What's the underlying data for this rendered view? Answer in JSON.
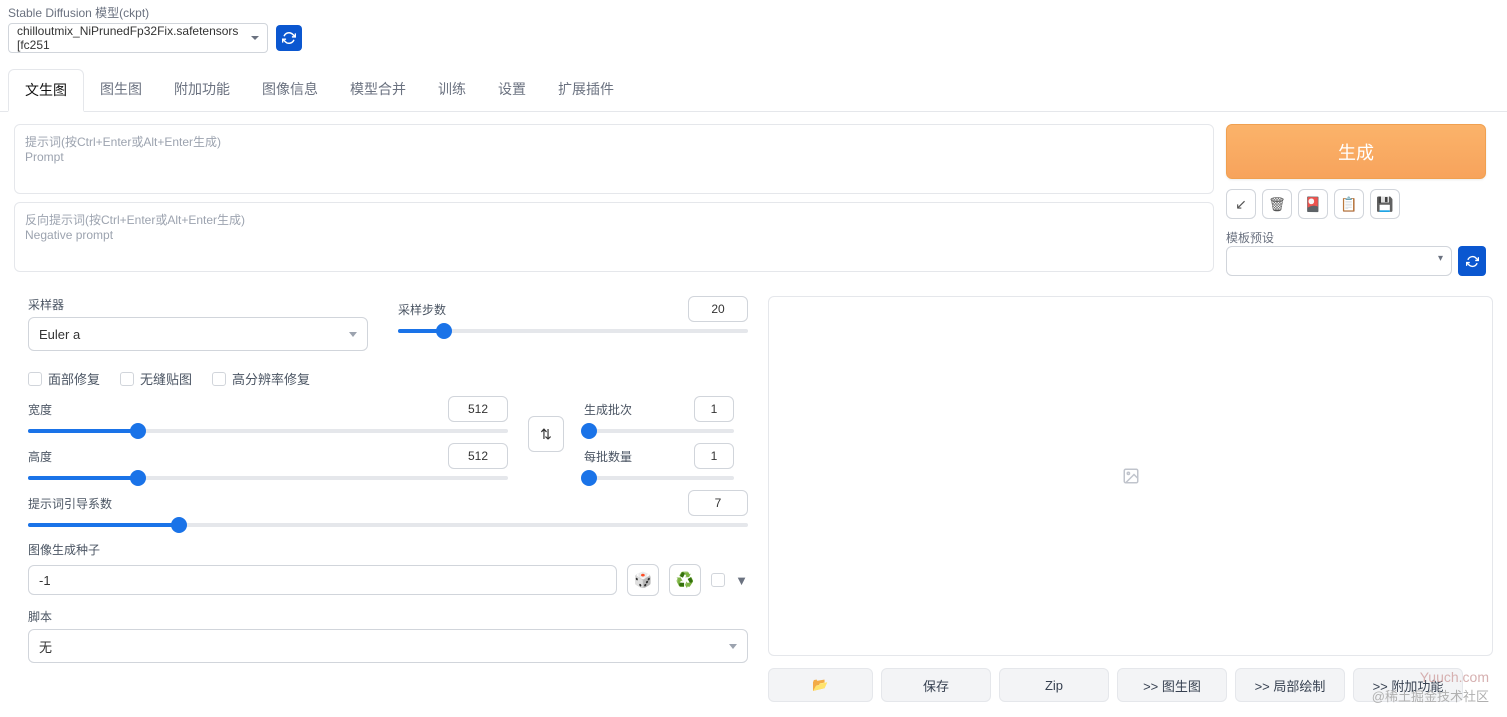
{
  "model": {
    "label": "Stable Diffusion 模型(ckpt)",
    "selected": "chilloutmix_NiPrunedFp32Fix.safetensors [fc251"
  },
  "tabs": [
    "文生图",
    "图生图",
    "附加功能",
    "图像信息",
    "模型合并",
    "训练",
    "设置",
    "扩展插件"
  ],
  "prompt": {
    "ph_cn": "提示词(按Ctrl+Enter或Alt+Enter生成)",
    "ph_en": "Prompt"
  },
  "neg_prompt": {
    "ph_cn": "反向提示词(按Ctrl+Enter或Alt+Enter生成)",
    "ph_en": "Negative prompt"
  },
  "generate_label": "生成",
  "preset_label": "模板预设",
  "sampler": {
    "label": "采样器",
    "value": "Euler a"
  },
  "steps": {
    "label": "采样步数",
    "value": "20"
  },
  "checks": {
    "face": "面部修复",
    "tile": "无缝贴图",
    "hires": "高分辨率修复"
  },
  "width": {
    "label": "宽度",
    "value": "512"
  },
  "height": {
    "label": "高度",
    "value": "512"
  },
  "batch_count": {
    "label": "生成批次",
    "value": "1"
  },
  "batch_size": {
    "label": "每批数量",
    "value": "1"
  },
  "cfg": {
    "label": "提示词引导系数",
    "value": "7"
  },
  "seed": {
    "label": "图像生成种子",
    "value": "-1"
  },
  "script": {
    "label": "脚本",
    "value": "无"
  },
  "out_btns": {
    "folder": "📂",
    "save": "保存",
    "zip": "Zip",
    "img2img": ">> 图生图",
    "inpaint": ">> 局部绘制",
    "extras": ">> 附加功能"
  },
  "watermark1": "Yuuch.com",
  "watermark2": "@稀土掘金技术社区"
}
